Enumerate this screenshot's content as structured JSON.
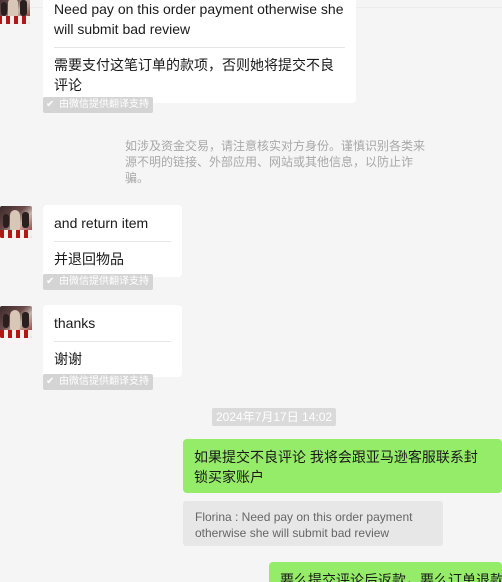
{
  "messages": [
    {
      "original": "Need pay on this order payment otherwise she will submit bad review",
      "translation": "需要支付这笔订单的款项，否则她将提交不良评论",
      "translation_credit": "由微信提供翻译支持"
    },
    {
      "original": "and return item",
      "translation": "并退回物品",
      "translation_credit": "由微信提供翻译支持"
    },
    {
      "original": "thanks",
      "translation": "谢谢",
      "translation_credit": "由微信提供翻译支持"
    }
  ],
  "system_notice": "如涉及资金交易，请注意核实对方身份。谨慎识别各类来源不明的链接、外部应用、网站或其他信息，以防止诈骗。",
  "timestamp": "2024年7月17日 14:02",
  "sent_messages": [
    {
      "text": "如果提交不良评论  我将会跟亚马逊客服联系封锁买家账户"
    },
    {
      "text": "要么提交评论后返款，要么订单退款"
    }
  ],
  "quote": {
    "text": "Florina : Need pay on this order payment otherwise she will submit bad review"
  },
  "colors": {
    "background": "#f5f5f5",
    "incoming_bubble": "#ffffff",
    "outgoing_bubble": "#95ec69",
    "tag": "#d4d4d4"
  }
}
